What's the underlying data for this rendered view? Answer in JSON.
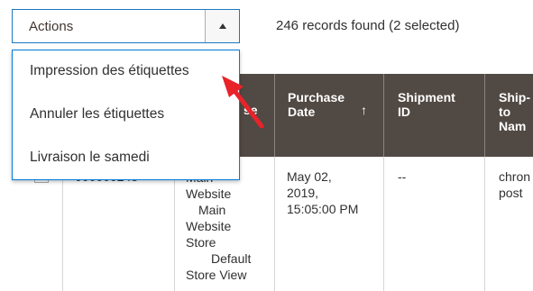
{
  "actions": {
    "label": "Actions",
    "toggle_icon": "triangle-up-icon"
  },
  "records_text": "246 records found (2 selected)",
  "dropdown": {
    "items": [
      {
        "label": "Impression des étiquettes"
      },
      {
        "label": "Annuler les étiquettes"
      },
      {
        "label": "Livraison le samedi"
      }
    ]
  },
  "grid": {
    "headers": {
      "partial": "se",
      "purchase_date_line1": "Purchase",
      "purchase_date_line2": "Date",
      "sort_icon": "↑",
      "shipment_id_line1": "Shipment",
      "shipment_id_line2": "ID",
      "ship_to_line1": "Ship-",
      "ship_to_line2": "to",
      "ship_to_line3": "Nam"
    },
    "row": {
      "id_partial": "000000248",
      "store_lines": [
        "Main",
        "Website",
        "Main",
        "Website",
        "Store",
        "Default",
        "Store View"
      ],
      "purchase_date_line1": "May 02,",
      "purchase_date_line2": "2019,",
      "purchase_date_line3": "15:05:00 PM",
      "shipment_id": "--",
      "ship_to_line1": "chron",
      "ship_to_line2": "post"
    }
  },
  "colors": {
    "header_bg": "#514943",
    "accent_blue": "#1979c3",
    "annotation_red": "#e8232a"
  }
}
